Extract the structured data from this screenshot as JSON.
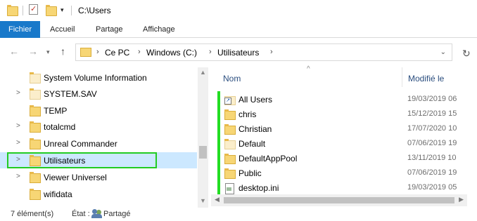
{
  "window": {
    "title": "C:\\Users"
  },
  "ribbon": {
    "tabs": [
      {
        "label": "Fichier"
      },
      {
        "label": "Accueil"
      },
      {
        "label": "Partage"
      },
      {
        "label": "Affichage"
      }
    ]
  },
  "address": {
    "crumbs": [
      "Ce PC",
      "Windows (C:)",
      "Utilisateurs"
    ]
  },
  "tree": {
    "items": [
      {
        "label": "System Volume Information",
        "expandable": false,
        "pale": true
      },
      {
        "label": "SYSTEM.SAV",
        "expandable": true,
        "pale": true
      },
      {
        "label": "TEMP",
        "expandable": false,
        "pale": false
      },
      {
        "label": "totalcmd",
        "expandable": true,
        "pale": false
      },
      {
        "label": "Unreal Commander",
        "expandable": true,
        "pale": false
      },
      {
        "label": "Utilisateurs",
        "expandable": true,
        "pale": false,
        "selected": true
      },
      {
        "label": "Viewer Universel",
        "expandable": true,
        "pale": false
      },
      {
        "label": "wifidata",
        "expandable": false,
        "pale": false
      }
    ]
  },
  "files": {
    "columns": {
      "name": "Nom",
      "modified": "Modifié le"
    },
    "rows": [
      {
        "name": "All Users",
        "modified": "19/03/2019 06",
        "icon": "shortcut-folder-icon"
      },
      {
        "name": "chris",
        "modified": "15/12/2019 15",
        "icon": "folder-icon"
      },
      {
        "name": "Christian",
        "modified": "17/07/2020 10",
        "icon": "folder-icon"
      },
      {
        "name": "Default",
        "modified": "07/06/2019 19",
        "icon": "pale-folder-icon"
      },
      {
        "name": "DefaultAppPool",
        "modified": "13/11/2019 10",
        "icon": "folder-icon"
      },
      {
        "name": "Public",
        "modified": "07/06/2019 19",
        "icon": "folder-icon"
      },
      {
        "name": "desktop.ini",
        "modified": "19/03/2019 05",
        "icon": "settings-file-icon"
      }
    ]
  },
  "status": {
    "count": "7 élément(s)",
    "state_label": "État :",
    "state_value": "Partagé"
  },
  "colors": {
    "accent": "#1979ca",
    "selection": "#cce8ff",
    "highlight": "#22cc22"
  }
}
